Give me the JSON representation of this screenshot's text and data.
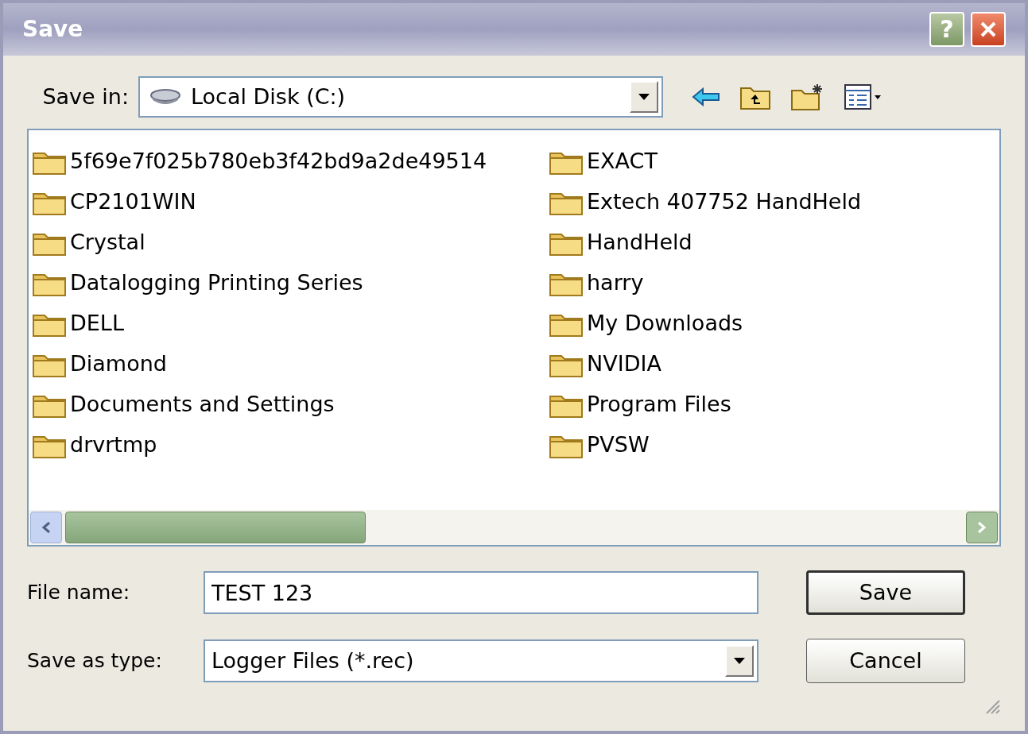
{
  "window": {
    "title": "Save",
    "help_label": "?"
  },
  "save_in": {
    "label": "Save in:",
    "value": "Local Disk (C:)"
  },
  "files": [
    {
      "name": "5f69e7f025b780eb3f42bd9a2de49514"
    },
    {
      "name": "CP2101WIN"
    },
    {
      "name": "Crystal"
    },
    {
      "name": "Datalogging Printing Series"
    },
    {
      "name": "DELL"
    },
    {
      "name": "Diamond"
    },
    {
      "name": "Documents and Settings"
    },
    {
      "name": "drvrtmp"
    },
    {
      "name": "EXACT"
    },
    {
      "name": "Extech 407752 HandHeld"
    },
    {
      "name": "HandHeld"
    },
    {
      "name": "harry"
    },
    {
      "name": "My Downloads"
    },
    {
      "name": "NVIDIA"
    },
    {
      "name": "Program Files"
    },
    {
      "name": "PVSW"
    }
  ],
  "file_name": {
    "label": "File name:",
    "value": "TEST 123"
  },
  "save_as_type": {
    "label": "Save as type:",
    "value": "Logger Files (*.rec)"
  },
  "buttons": [
    {
      "label": "Save",
      "default": true
    },
    {
      "label": "Cancel",
      "default": false
    }
  ]
}
